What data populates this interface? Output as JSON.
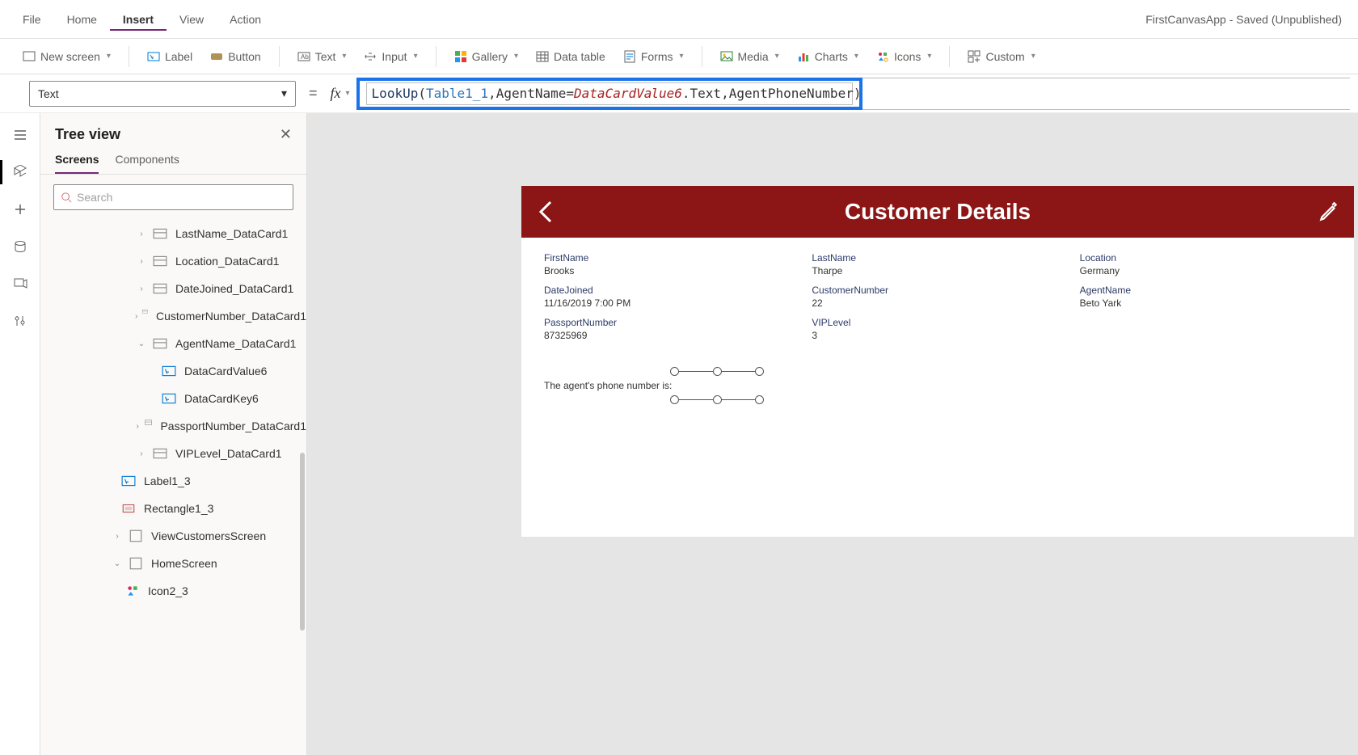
{
  "app_title": "FirstCanvasApp - Saved (Unpublished)",
  "menu": {
    "file": "File",
    "home": "Home",
    "insert": "Insert",
    "view": "View",
    "action": "Action"
  },
  "ribbon": {
    "new_screen": "New screen",
    "label": "Label",
    "button": "Button",
    "text": "Text",
    "input": "Input",
    "gallery": "Gallery",
    "data_table": "Data table",
    "forms": "Forms",
    "media": "Media",
    "charts": "Charts",
    "icons": "Icons",
    "custom": "Custom"
  },
  "property_dd": "Text",
  "formula": {
    "fn": "LookUp",
    "ds": "Table1_1",
    "lhs": "AgentName",
    "ref_pre": "DataCardVa",
    "ref_post": "lue6",
    "suffix": ".Text",
    "col": "AgentPhoneNumber"
  },
  "tree": {
    "title": "Tree view",
    "tab_screens": "Screens",
    "tab_components": "Components",
    "search_ph": "Search",
    "items": [
      "LastName_DataCard1",
      "Location_DataCard1",
      "DateJoined_DataCard1",
      "CustomerNumber_DataCard1",
      "AgentName_DataCard1",
      "DataCardValue6",
      "DataCardKey6",
      "PassportNumber_DataCard1",
      "VIPLevel_DataCard1",
      "Label1_3",
      "Rectangle1_3",
      "ViewCustomersScreen",
      "HomeScreen",
      "Icon2_3"
    ]
  },
  "phone": {
    "title": "Customer Details",
    "fields": {
      "firstname_l": "FirstName",
      "firstname_v": "Brooks",
      "lastname_l": "LastName",
      "lastname_v": "Tharpe",
      "location_l": "Location",
      "location_v": "Germany",
      "datejoined_l": "DateJoined",
      "datejoined_v": "11/16/2019 7:00 PM",
      "custno_l": "CustomerNumber",
      "custno_v": "22",
      "agent_l": "AgentName",
      "agent_v": "Beto Yark",
      "passport_l": "PassportNumber",
      "passport_v": "87325969",
      "vip_l": "VIPLevel",
      "vip_v": "3"
    },
    "agent_text": "The agent's phone number is:"
  }
}
